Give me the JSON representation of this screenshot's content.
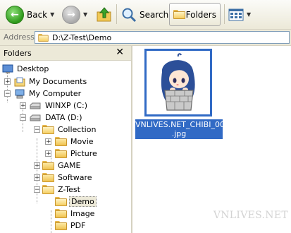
{
  "toolbar": {
    "back_label": "Back",
    "search_label": "Search",
    "folders_label": "Folders"
  },
  "address": {
    "label": "Address",
    "value": "D:\\Z-Test\\Demo"
  },
  "folders_pane": {
    "title": "Folders",
    "close_glyph": "✕",
    "tree": {
      "desktop": "Desktop",
      "my_documents": "My Documents",
      "my_computer": "My Computer",
      "winxp": "WINXP (C:)",
      "data": "DATA (D:)",
      "collection": "Collection",
      "movie": "Movie",
      "picture": "Picture",
      "game": "GAME",
      "software": "Software",
      "ztest": "Z-Test",
      "demo": "Demo",
      "image": "Image",
      "pdf": "PDF"
    }
  },
  "file": {
    "name_line1": "VNLIVES.NET_CHIBI_001",
    "name_line2": ".jpg"
  },
  "watermark": "VNLIVES.NET",
  "colors": {
    "selection": "#316ac5",
    "chrome": "#ece9d8"
  }
}
